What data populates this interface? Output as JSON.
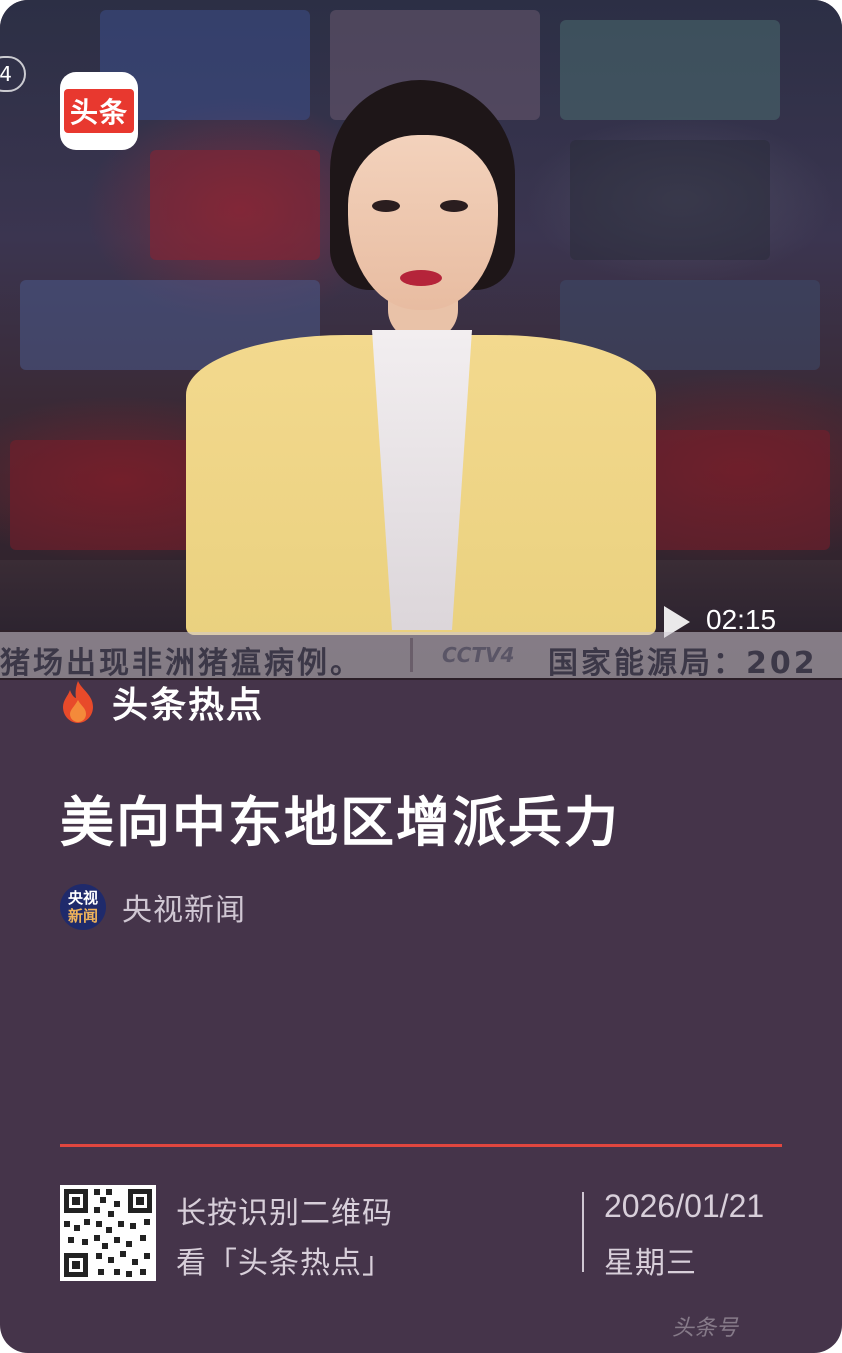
{
  "video": {
    "corner_badge": "4",
    "app_logo_text": "头条",
    "duration": "02:15",
    "ticker_left": "猪场出现非洲猪瘟病例。",
    "ticker_station": "CCTV4",
    "ticker_right": "国家能源局：202"
  },
  "section": {
    "icon": "flame-icon",
    "title": "头条热点"
  },
  "headline": "美向中东地区增派兵力",
  "source": {
    "avatar_line1": "央视",
    "avatar_line2": "新闻",
    "name": "央视新闻"
  },
  "footer": {
    "qr_line1": "长按识别二维码",
    "qr_line2": "看「头条热点」",
    "date": "2026/01/21",
    "weekday": "星期三"
  },
  "watermark": "头条号",
  "colors": {
    "background": "#45344a",
    "accent_red": "#e0463f",
    "logo_red": "#e8382f"
  }
}
